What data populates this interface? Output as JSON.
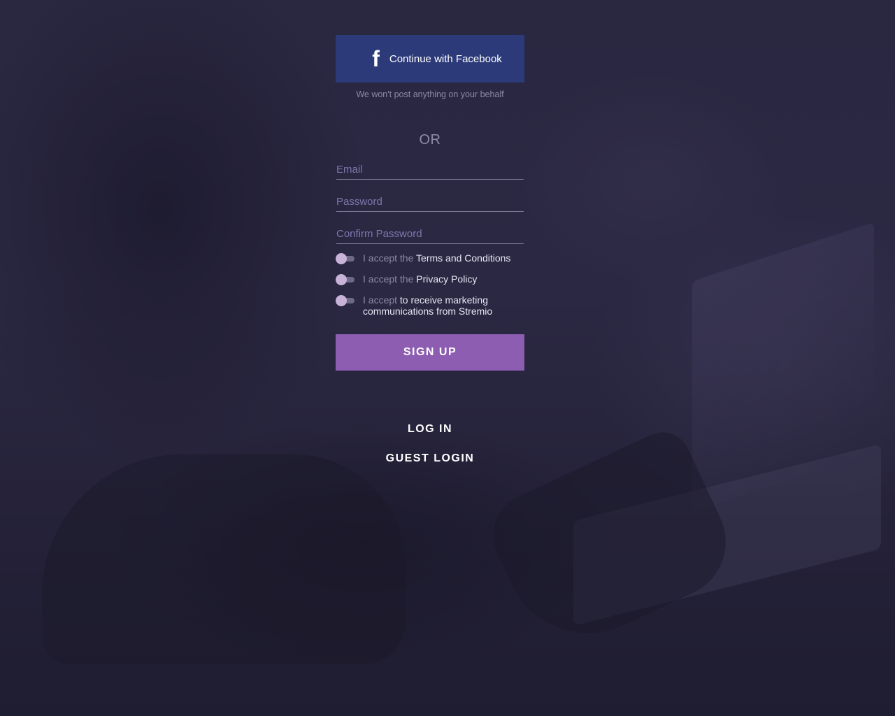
{
  "facebook": {
    "label": "Continue with Facebook",
    "icon": "facebook-icon",
    "note": "We won't post anything on your behalf"
  },
  "divider": {
    "label": "OR"
  },
  "form": {
    "email_placeholder": "Email",
    "email_value": "",
    "password_placeholder": "Password",
    "password_value": "",
    "confirm_placeholder": "Confirm Password",
    "confirm_value": ""
  },
  "consents": [
    {
      "prefix": "I accept the",
      "link": "Terms and Conditions",
      "checked": false
    },
    {
      "prefix": "I accept the",
      "link": "Privacy Policy",
      "checked": false
    },
    {
      "prefix": "I accept",
      "link": "to receive marketing communications from Stremio",
      "checked": false
    }
  ],
  "actions": {
    "signup_label": "SIGN UP",
    "login_label": "LOG IN",
    "guest_label": "GUEST LOGIN"
  },
  "colors": {
    "facebook_blue": "#2c3a79",
    "signup_purple": "#8c5db0",
    "background": "#26233c"
  }
}
